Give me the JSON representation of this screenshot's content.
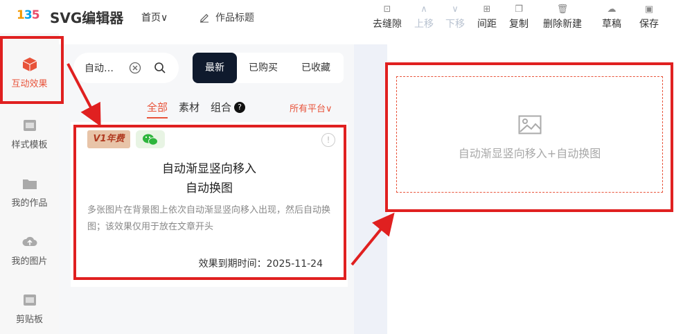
{
  "header": {
    "brand": "SVG编辑器",
    "home": "首页∨",
    "title": "作品标题",
    "tools": [
      {
        "label": "去缝隙",
        "icon": "grid-icon",
        "disabled": false
      },
      {
        "label": "上移",
        "icon": "chevron-up-icon",
        "disabled": true
      },
      {
        "label": "下移",
        "icon": "chevron-down-icon",
        "disabled": true
      },
      {
        "label": "间距",
        "icon": "spacing-icon",
        "disabled": false
      },
      {
        "label": "复制",
        "icon": "copy-icon",
        "disabled": false
      },
      {
        "label": "删除新建",
        "icon": "trash-icon",
        "disabled": false
      },
      {
        "label": "草稿",
        "icon": "cloud-icon",
        "disabled": false
      },
      {
        "label": "保存",
        "icon": "save-icon",
        "disabled": false
      }
    ]
  },
  "sidebar": {
    "items": [
      {
        "label": "互动效果",
        "icon": "cube-icon"
      },
      {
        "label": "样式模板",
        "icon": "template-icon"
      },
      {
        "label": "我的作品",
        "icon": "folder-icon"
      },
      {
        "label": "我的图片",
        "icon": "cloud-upload-icon"
      },
      {
        "label": "剪贴板",
        "icon": "clipboard-icon"
      }
    ]
  },
  "search": {
    "value": "自动…"
  },
  "segments": [
    "最新",
    "已购买",
    "已收藏"
  ],
  "subtabs": [
    "全部",
    "素材",
    "组合"
  ],
  "platform": "所有平台∨",
  "card": {
    "badge": "V1年费",
    "title_line1": "自动渐显竖向移入",
    "title_line2": "自动换图",
    "description": "多张图片在背景图上依次自动渐显竖向移入出现，然后自动换图；该效果仅用于放在文章开头",
    "expiry": "效果到期时间：2025-11-24"
  },
  "canvas": {
    "placeholder": "自动渐显竖向移入+自动换图"
  },
  "colors": {
    "accent": "#e8533a",
    "highlight": "#e02020",
    "dark": "#0f1a2d"
  }
}
